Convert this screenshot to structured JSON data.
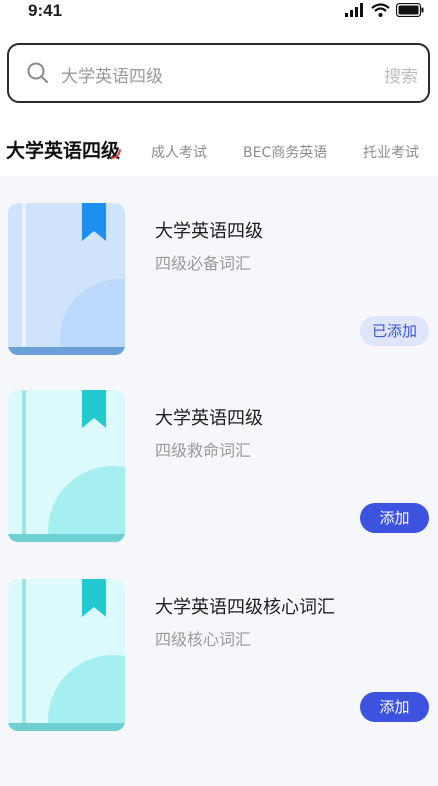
{
  "status_bar": {
    "time": "9:41"
  },
  "search": {
    "placeholder": "大学英语四级",
    "button_label": "搜索"
  },
  "tabs": [
    {
      "label": "大学英语四级",
      "active": true
    },
    {
      "label": "成人考试",
      "active": false
    },
    {
      "label": "BEC商务英语",
      "active": false
    },
    {
      "label": "托业考试",
      "active": false
    }
  ],
  "books": [
    {
      "title": "大学英语四级",
      "subtitle": "四级必备词汇",
      "button_label": "已添加",
      "added": true,
      "theme": "blue"
    },
    {
      "title": "大学英语四级",
      "subtitle": "四级救命词汇",
      "button_label": "添加",
      "added": false,
      "theme": "teal"
    },
    {
      "title": "大学英语四级核心词汇",
      "subtitle": "四级核心词汇",
      "button_label": "添加",
      "added": false,
      "theme": "teal"
    }
  ],
  "colors": {
    "primary": "#3c53e0",
    "added_bg": "#dfe6fb",
    "book_blue": "#cfe3fb",
    "book_teal": "#dcfafb",
    "bookmark_blue": "#1f8ef1",
    "bookmark_teal": "#22c9cf"
  }
}
